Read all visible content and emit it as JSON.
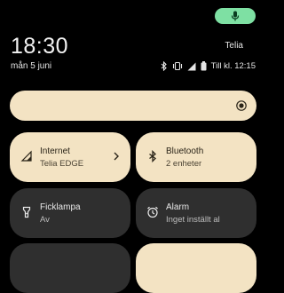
{
  "status": {
    "time": "18:30",
    "date": "mån 5 juni",
    "carrier": "Telia",
    "alarm_text": "Till kl. 12:15"
  },
  "icons": {
    "mic": "microphone-icon",
    "bluetooth": "bluetooth-icon",
    "vibrate": "vibrate-icon",
    "signal": "signal-icon",
    "battery": "battery-icon",
    "brightness": "brightness-icon"
  },
  "tiles": [
    {
      "title": "Internet",
      "subtitle": "Telia EDGE",
      "active": true,
      "icon": "signal-icon",
      "has_chevron": true
    },
    {
      "title": "Bluetooth",
      "subtitle": "2 enheter",
      "active": true,
      "icon": "bluetooth-icon"
    },
    {
      "title": "Ficklampa",
      "subtitle": "Av",
      "active": false,
      "icon": "flashlight-icon"
    },
    {
      "title": "Alarm",
      "subtitle": "Inget inställt al",
      "active": false,
      "icon": "alarm-icon"
    },
    {
      "title": "",
      "subtitle": "",
      "active": false
    },
    {
      "title": "",
      "subtitle": "",
      "active": true
    }
  ],
  "colors": {
    "background": "#000000",
    "tile_active": "#f3e3c3",
    "tile_inactive": "#2f2f2f",
    "mic_pill": "#7ee0a3"
  }
}
